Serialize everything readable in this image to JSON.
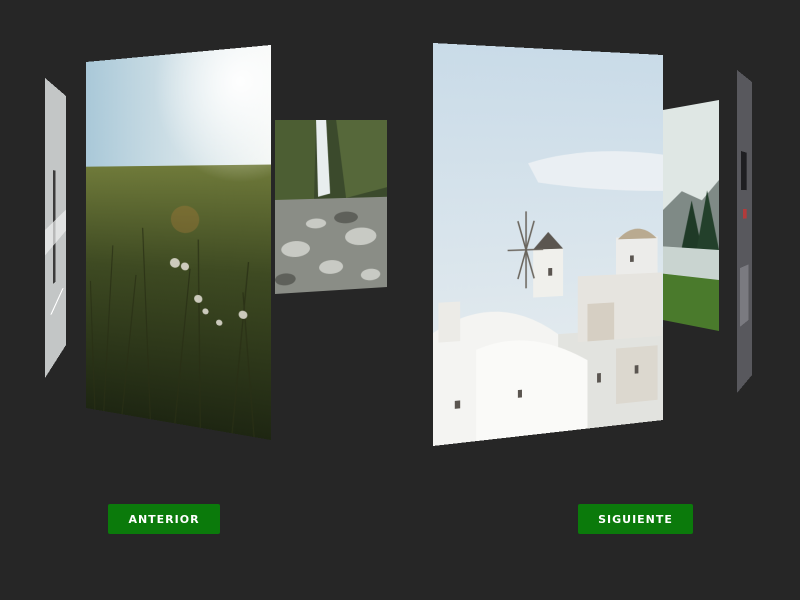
{
  "carousel": {
    "prev_label": "ANTERIOR",
    "next_label": "SIGUIENTE",
    "slides": [
      {
        "subject": "tree trunk in fog",
        "image_icon": "forest-photo"
      },
      {
        "subject": "wild grass meadow at sunset",
        "image_icon": "meadow-photo"
      },
      {
        "subject": "waterfall over rocky riverbed",
        "image_icon": "waterfall-photo"
      },
      {
        "subject": "white village with windmill under blue sky",
        "image_icon": "village-photo"
      },
      {
        "subject": "misty mountains with lake and pine trees",
        "image_icon": "mountain-photo"
      },
      {
        "subject": "figure in dark room",
        "image_icon": "portrait-photo"
      }
    ]
  },
  "colors": {
    "background": "#262626",
    "button": "#0b7a0b",
    "button_text": "#ffffff"
  }
}
